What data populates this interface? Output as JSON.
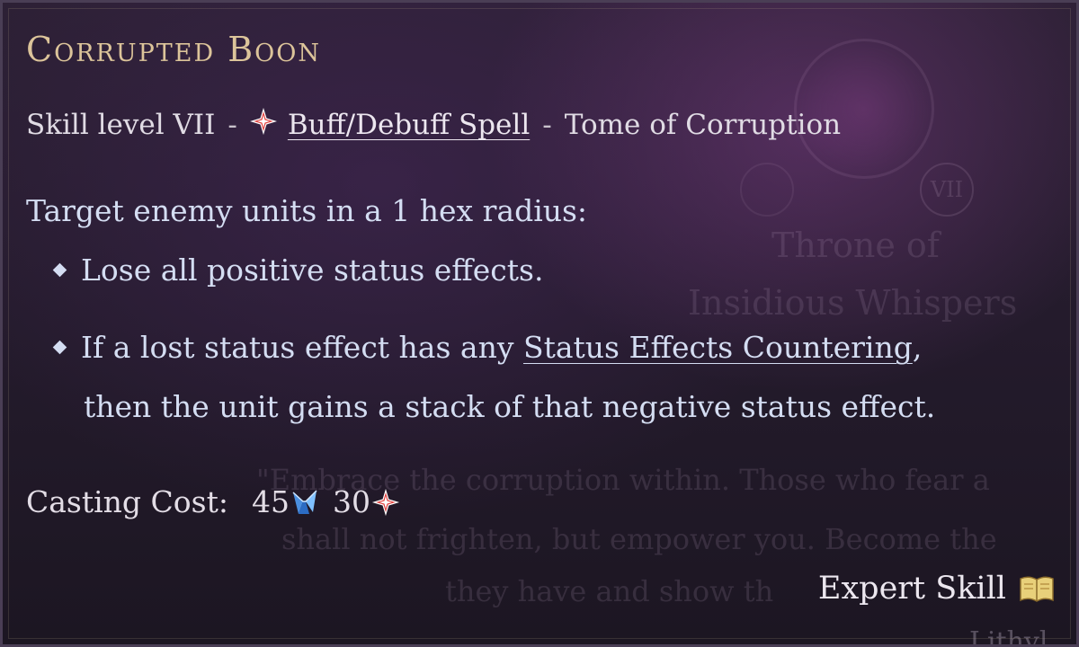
{
  "tooltip": {
    "title": "Corrupted Boon",
    "skill_level": "Skill level VII",
    "separator": "-",
    "spell_type": "Buff/Debuff Spell",
    "tome": "Tome of Corruption",
    "target_line": "Target enemy units in a 1 hex radius:",
    "bullet1": "Lose all positive status effects.",
    "bullet2_pre": "If a lost status effect has any ",
    "bullet2_link": "Status Effects Countering",
    "bullet2_post": ",",
    "bullet2_cont": "then the unit gains a stack of that negative status effect.",
    "cost_label": "Casting Cost:",
    "cost_mana": "45",
    "cost_mana_icon": "mana-crystal-icon",
    "cost_spell": "30",
    "cost_spell_icon": "spell-star-icon",
    "expert_label": "Expert Skill",
    "expert_icon": "open-book-icon"
  },
  "background": {
    "emblem_numeral": "VII",
    "throne_line1": "Throne of",
    "throne_line2": "Insidious Whispers",
    "quote_line1": "\"Embrace the corruption within. Those who fear a",
    "quote_line2": "shall not frighten, but empower you. Become the",
    "quote_line3": "they have and show th",
    "corner_text": "Lithyl"
  },
  "colors": {
    "title": "#dcc49a",
    "body_text": "#d4ddf2",
    "border": "#4a3e55",
    "spell_icon_red": "#e0413f"
  }
}
